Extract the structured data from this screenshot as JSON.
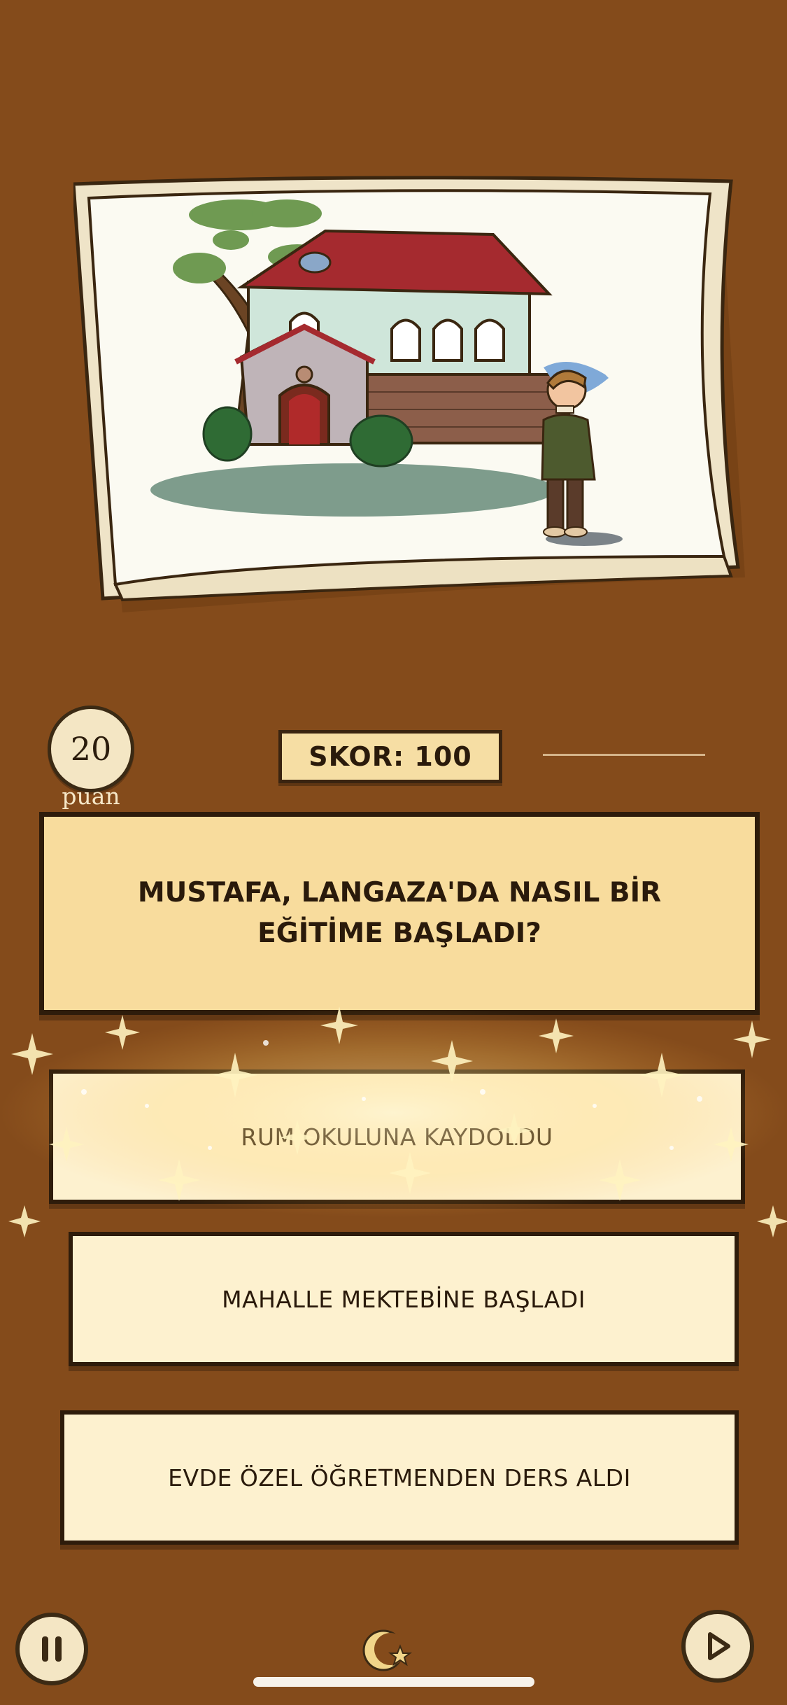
{
  "header": {
    "points_value": "20",
    "points_label": "puan",
    "score_text": "SKOR: 100"
  },
  "question": {
    "text": "MUSTAFA, LANGAZA'DA NASIL BİR EĞİTİME BAŞLADI?"
  },
  "answers": [
    {
      "label": "RUM OKULUNA KAYDOLDU"
    },
    {
      "label": "MAHALLE MEKTEBİNE BAŞLADI"
    },
    {
      "label": "EVDE ÖZEL ÖĞRETMENDEN DERS ALDI"
    }
  ],
  "controls": {
    "pause_icon": "pause-icon",
    "play_icon": "play-icon",
    "logo_icon": "crescent-star-icon"
  },
  "colors": {
    "background": "#844b1b",
    "panel": "#f8dc9d",
    "answer": "#fdf1cf",
    "border": "#2e1c0b"
  }
}
